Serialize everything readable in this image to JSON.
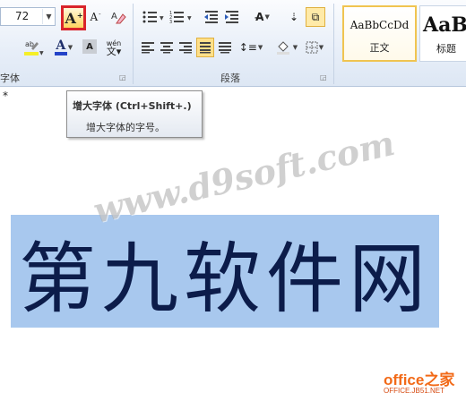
{
  "ribbon": {
    "font_group": {
      "label": "字体",
      "font_size": "72",
      "grow_font_label": "A",
      "grow_font_sup": "+",
      "shrink_font_label": "A",
      "shrink_font_sup": "-",
      "font_color_label": "A",
      "phonetic_label": "wén"
    },
    "paragraph_group": {
      "label": "段落"
    },
    "styles_group": {
      "styles": [
        {
          "preview": "AaBbCcDd",
          "name": "正文"
        },
        {
          "preview": "AaB",
          "name": "标题"
        }
      ]
    }
  },
  "tooltip": {
    "title": "增大字体 (Ctrl+Shift+.)",
    "description": "增大字体的字号。"
  },
  "document": {
    "stray_char": "*",
    "body_text": "第九软件网",
    "watermark": "www.d9soft.com"
  },
  "brand": {
    "name": "office之家",
    "url": "OFFICE.JB51.NET"
  },
  "colors": {
    "selection": "#a8c8ee",
    "text": "#0c1c4a",
    "highlight_callout": "#d9242b",
    "brand": "#f26a18"
  }
}
